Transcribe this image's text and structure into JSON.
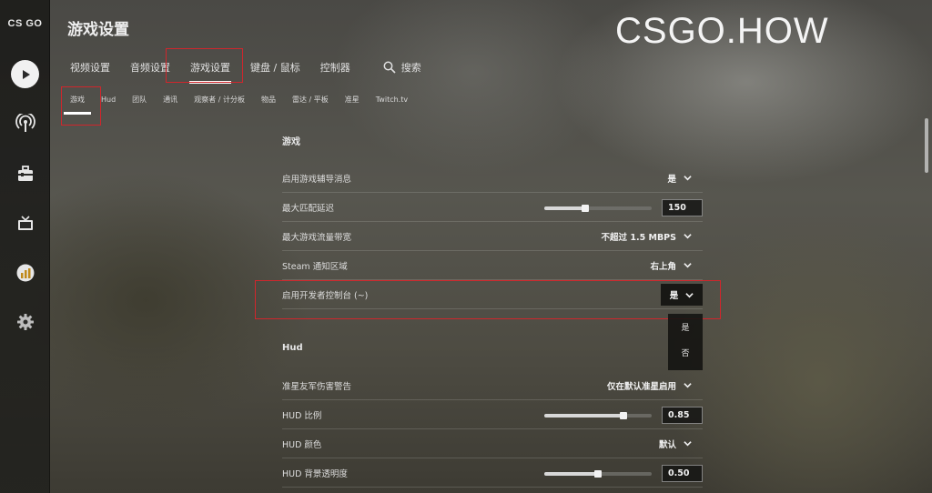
{
  "rail": {
    "logo_text": "CS GO",
    "items": [
      {
        "icon": "play-icon"
      },
      {
        "icon": "broadcast-icon"
      },
      {
        "icon": "briefcase-icon"
      },
      {
        "icon": "tv-icon"
      },
      {
        "icon": "stats-icon"
      },
      {
        "icon": "gear-icon"
      }
    ]
  },
  "header": {
    "title": "游戏设置",
    "watermark": "CSGO.HOW"
  },
  "main_tabs": [
    {
      "label": "视频设置",
      "active": false
    },
    {
      "label": "音频设置",
      "active": false
    },
    {
      "label": "游戏设置",
      "active": true
    },
    {
      "label": "键盘 / 鼠标",
      "active": false
    },
    {
      "label": "控制器",
      "active": false
    }
  ],
  "search_label": "搜索",
  "sub_tabs": [
    {
      "label": "游戏",
      "active": true
    },
    {
      "label": "Hud",
      "active": false
    },
    {
      "label": "团队",
      "active": false
    },
    {
      "label": "通讯",
      "active": false
    },
    {
      "label": "观察者 / 计分板",
      "active": false
    },
    {
      "label": "物品",
      "active": false
    },
    {
      "label": "雷达 / 平板",
      "active": false
    },
    {
      "label": "准星",
      "active": false
    },
    {
      "label": "Twitch.tv",
      "active": false
    }
  ],
  "sections": {
    "game": {
      "title": "游戏",
      "rows": {
        "hints": {
          "label": "启用游戏辅导消息",
          "value": "是"
        },
        "max_lag": {
          "label": "最大匹配延迟",
          "value": "150",
          "slider_fraction": 0.38
        },
        "bandwidth": {
          "label": "最大游戏流量带宽",
          "value": "不超过 1.5 MBPS"
        },
        "notify": {
          "label": "Steam 通知区域",
          "value": "右上角"
        },
        "console": {
          "label": "启用开发者控制台 (~)",
          "value": "是",
          "options": [
            "是",
            "否"
          ]
        }
      }
    },
    "hud": {
      "title": "Hud",
      "rows": {
        "ff_warning": {
          "label": "准星友军伤害警告",
          "value": "仅在默认准星启用"
        },
        "scale": {
          "label": "HUD 比例",
          "value": "0.85",
          "slider_fraction": 0.74
        },
        "color": {
          "label": "HUD 颜色",
          "value": "默认"
        },
        "alpha": {
          "label": "HUD 背景透明度",
          "value": "0.50",
          "slider_fraction": 0.5
        }
      }
    }
  },
  "colors": {
    "highlight_box": "#d0262c",
    "accent": "#ffffff"
  }
}
